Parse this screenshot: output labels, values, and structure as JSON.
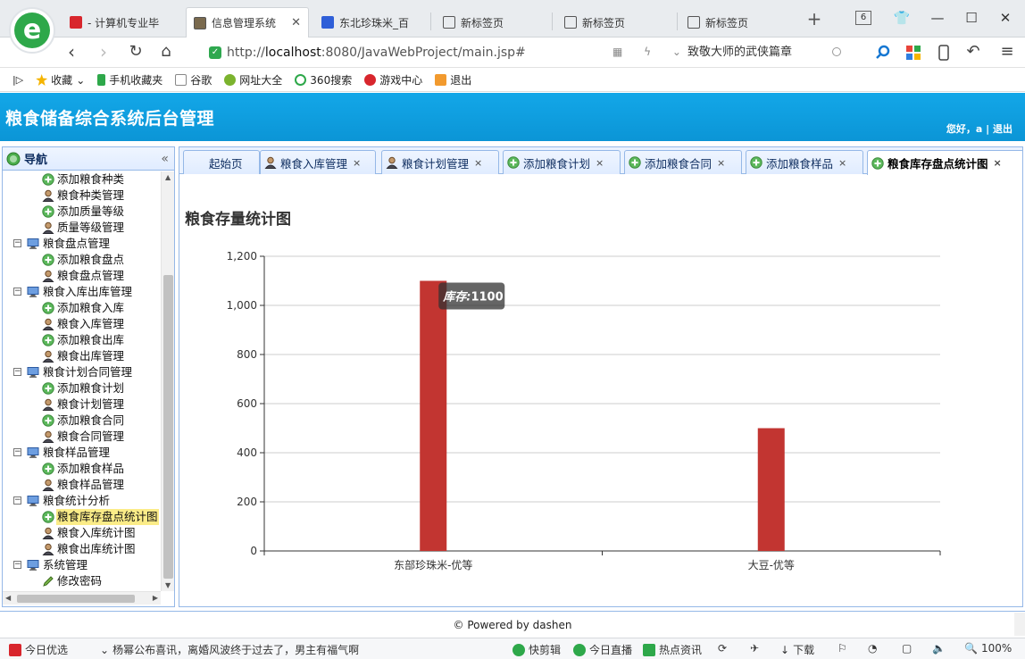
{
  "browser": {
    "tabs": [
      {
        "label": "- 计算机专业毕",
        "active": false
      },
      {
        "label": "信息管理系统",
        "active": true
      },
      {
        "label": "东北珍珠米_百",
        "active": false
      },
      {
        "label": "新标签页",
        "active": false
      },
      {
        "label": "新标签页",
        "active": false
      },
      {
        "label": "新标签页",
        "active": false
      }
    ],
    "tab_count": "6",
    "url_prefix": "http://",
    "url_host": "localhost",
    "url_rest": ":8080/JavaWebProject/main.jsp#",
    "search_text": "致敬大师的武侠篇章",
    "bookmarks": [
      "收藏",
      "手机收藏夹",
      "谷歌",
      "网址大全",
      "360搜索",
      "游戏中心",
      "退出"
    ]
  },
  "app": {
    "title": "粮食储备综合系统后台管理",
    "greeting": "您好，a",
    "logout": "退出"
  },
  "nav": {
    "title": "导航",
    "tree": [
      {
        "type": "leaf",
        "icon": "add",
        "label": "添加粮食种类"
      },
      {
        "type": "leaf",
        "icon": "user",
        "label": "粮食种类管理"
      },
      {
        "type": "leaf",
        "icon": "add",
        "label": "添加质量等级"
      },
      {
        "type": "leaf",
        "icon": "user",
        "label": "质量等级管理"
      },
      {
        "type": "folder",
        "label": "粮食盘点管理"
      },
      {
        "type": "leaf",
        "icon": "add",
        "label": "添加粮食盘点"
      },
      {
        "type": "leaf",
        "icon": "user",
        "label": "粮食盘点管理"
      },
      {
        "type": "folder",
        "label": "粮食入库出库管理"
      },
      {
        "type": "leaf",
        "icon": "add",
        "label": "添加粮食入库"
      },
      {
        "type": "leaf",
        "icon": "user",
        "label": "粮食入库管理"
      },
      {
        "type": "leaf",
        "icon": "add",
        "label": "添加粮食出库"
      },
      {
        "type": "leaf",
        "icon": "user",
        "label": "粮食出库管理"
      },
      {
        "type": "folder",
        "label": "粮食计划合同管理"
      },
      {
        "type": "leaf",
        "icon": "add",
        "label": "添加粮食计划"
      },
      {
        "type": "leaf",
        "icon": "user",
        "label": "粮食计划管理"
      },
      {
        "type": "leaf",
        "icon": "add",
        "label": "添加粮食合同"
      },
      {
        "type": "leaf",
        "icon": "user",
        "label": "粮食合同管理"
      },
      {
        "type": "folder",
        "label": "粮食样品管理"
      },
      {
        "type": "leaf",
        "icon": "add",
        "label": "添加粮食样品"
      },
      {
        "type": "leaf",
        "icon": "user",
        "label": "粮食样品管理"
      },
      {
        "type": "folder",
        "label": "粮食统计分析"
      },
      {
        "type": "leaf",
        "icon": "add",
        "label": "粮食库存盘点统计图",
        "selected": true
      },
      {
        "type": "leaf",
        "icon": "user",
        "label": "粮食入库统计图"
      },
      {
        "type": "leaf",
        "icon": "user",
        "label": "粮食出库统计图"
      },
      {
        "type": "folder",
        "label": "系统管理"
      },
      {
        "type": "leaf",
        "icon": "pencil",
        "label": "修改密码"
      }
    ]
  },
  "content_tabs": [
    {
      "label": "起始页",
      "icon": "none",
      "closable": false
    },
    {
      "label": "粮食入库管理",
      "icon": "user",
      "closable": true
    },
    {
      "label": "粮食计划管理",
      "icon": "user",
      "closable": true
    },
    {
      "label": "添加粮食计划",
      "icon": "add",
      "closable": true
    },
    {
      "label": "添加粮食合同",
      "icon": "add",
      "closable": true
    },
    {
      "label": "添加粮食样品",
      "icon": "add",
      "closable": true
    },
    {
      "label": "粮食库存盘点统计图",
      "icon": "add",
      "closable": true,
      "active": true
    }
  ],
  "chart_data": {
    "type": "bar",
    "title": "粮食存量统计图",
    "categories": [
      "东部珍珠米-优等",
      "大豆-优等"
    ],
    "series": [
      {
        "name": "库存",
        "values": [
          1100,
          500
        ]
      }
    ],
    "ylim": [
      0,
      1200
    ],
    "yticks": [
      0,
      200,
      400,
      600,
      800,
      1000,
      1200
    ],
    "ytick_labels": [
      "0",
      "200",
      "400",
      "600",
      "800",
      "1,000",
      "1,200"
    ],
    "grid": true,
    "color": "#c23531",
    "tooltip": {
      "label": "库存:",
      "value": "1100"
    }
  },
  "footer": {
    "text": "© Powered by dashen"
  },
  "statusbar": {
    "left1": "今日优选",
    "left2": "杨幂公布喜讯，离婚风波终于过去了，男主有福气啊",
    "r1": "快剪辑",
    "r2": "今日直播",
    "r3": "热点资讯",
    "r4": "下载",
    "zoom": "100%"
  }
}
